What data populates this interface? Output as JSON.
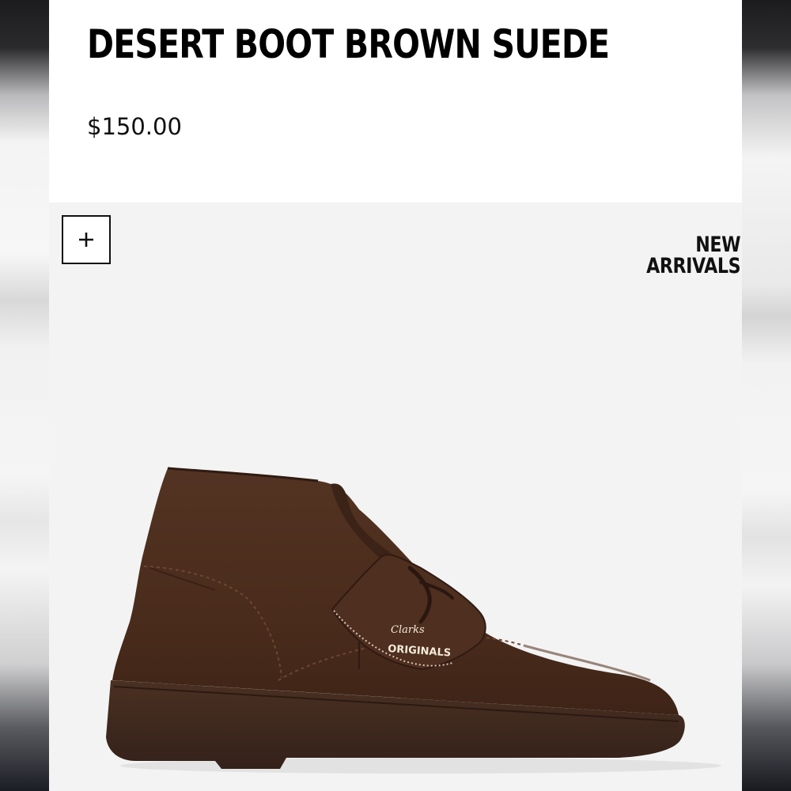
{
  "product": {
    "title": "DESERT BOOT BROWN SUEDE",
    "price": "$150.00"
  },
  "gallery": {
    "zoom_icon": "plus-icon",
    "badge_line1": "NEW",
    "badge_line2": "ARRIVALS",
    "image_alt": "Brown suede desert boot",
    "brand_tag_line1": "Clarks",
    "brand_tag_line2": "ORIGINALS"
  },
  "colors": {
    "text": "#000000",
    "image_background": "#f3f3f3",
    "suede": "#4a2c1c",
    "sole": "#3c261a"
  }
}
